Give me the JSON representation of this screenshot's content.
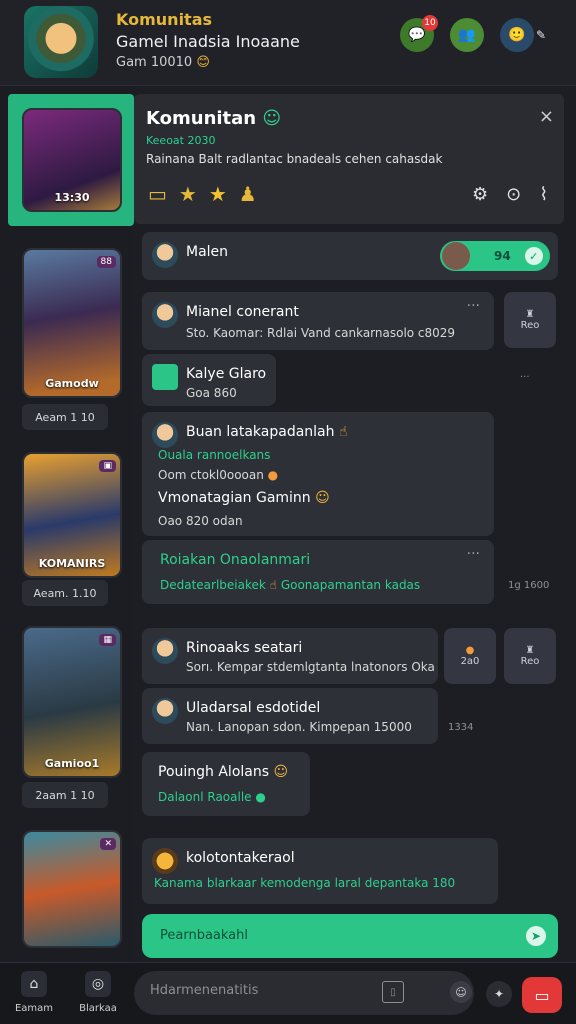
{
  "header": {
    "app_title": "Komunitas",
    "subtitle": "Gamel Inadsia Inoaane",
    "status": "Gam 10010",
    "status_emoji": "😊",
    "icons": [
      "chat-icon",
      "group-icon",
      "profile-icon"
    ],
    "badge": "10"
  },
  "sidebar": {
    "cards": [
      {
        "label": "13:30"
      },
      {
        "label": "Gamodw",
        "caption": "Aeam 1 10"
      },
      {
        "label": "KOMANIRS",
        "caption": "Aeam. 1.10"
      },
      {
        "label": "Gamioo1",
        "caption": "2aam 1 10"
      },
      {
        "label": "",
        "caption": ""
      }
    ]
  },
  "panel": {
    "title": "Komunitan",
    "sub1": "Keeoat 2030",
    "sub2": "Rainana Balt radlantac bnadeals cehen cahasdak",
    "close": "×",
    "actions": [
      "▭",
      "★",
      "★",
      "♟"
    ],
    "controls": [
      "⚙",
      "⊙",
      "⌇"
    ]
  },
  "messages": {
    "m1": {
      "name": "Malen",
      "pill_count": "94",
      "pill_check": "✓"
    },
    "m2": {
      "name": "Mianel conerant",
      "text": "Sto. Kaomar: Rdlai Vand cankarnasolo c8029"
    },
    "m3": {
      "name": "Kalye Glaro",
      "text": "Goa 860"
    },
    "m4": {
      "name": "Buan latakapadanlah",
      "line1": "Ouala rannoelkans",
      "line2": "Oom ctokl0oooan",
      "line3": "Vmonatagian Gaminn",
      "line4": "Oao 820 odan"
    },
    "m5": {
      "name": "Roiakan Onaolanmari",
      "text": "Dedatearlbeiakek",
      "text2": "Goonapamantan kadas",
      "time": "1g 1600"
    },
    "m6": {
      "name": "Rinoaaks seatari",
      "text": "Sorı. Kempar stdemlgtanta lnatonors Oka",
      "side_label": "2a0"
    },
    "m7": {
      "name": "Uladarsal esdotidel",
      "text": "Nan. Lanopan sdon. Kimpepan 15000",
      "time": "1334"
    },
    "m8": {
      "name": "Pouingh Alolans",
      "text": "Dalaonl Raoalle"
    },
    "m9": {
      "name": "kolotontakeraol",
      "text": "Kanama blarkaar kemodenga laral depantaka 180"
    }
  },
  "composer": {
    "placeholder": "Pearnbaakahl"
  },
  "bottom_nav": {
    "home": "Eamam",
    "community": "Blarkaa",
    "search_placeholder": "Hdarmenenatitis"
  },
  "colors": {
    "accent": "#2bc587",
    "alert": "#e23838",
    "gold": "#e5b83a"
  }
}
